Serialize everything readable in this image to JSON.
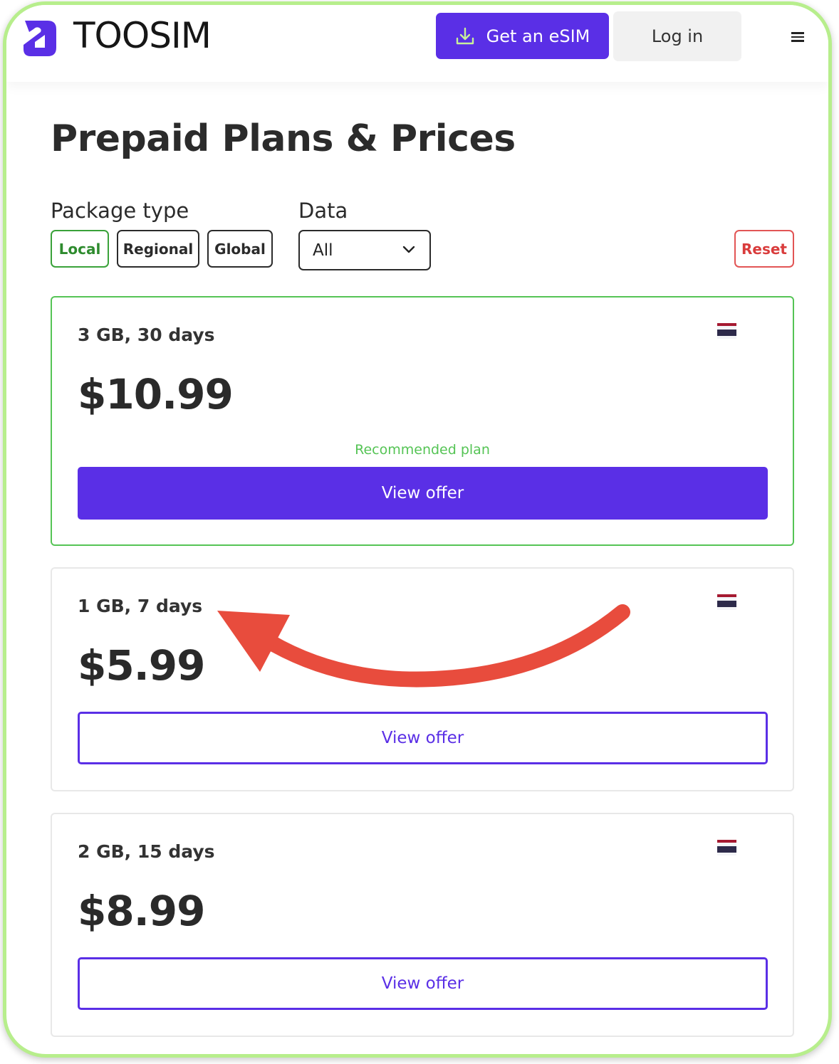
{
  "header": {
    "brand": "TOOSIM",
    "get_esim_label": "Get an eSIM",
    "login_label": "Log in"
  },
  "page": {
    "title": "Prepaid Plans & Prices"
  },
  "filters": {
    "package_type_label": "Package type",
    "package_types": [
      "Local",
      "Regional",
      "Global"
    ],
    "active_package_type": "Local",
    "data_label": "Data",
    "data_value": "All",
    "reset_label": "Reset"
  },
  "plans": [
    {
      "title": "3 GB, 30 days",
      "price": "$10.99",
      "badge": "Recommended plan",
      "button": "View offer"
    },
    {
      "title": "1 GB, 7 days",
      "price": "$5.99",
      "button": "View offer"
    },
    {
      "title": "2 GB, 15 days",
      "price": "$8.99",
      "button": "View offer"
    }
  ],
  "colors": {
    "accent": "#5a2fe6",
    "recommended": "#55c455",
    "reset": "#e25555",
    "annotation_arrow": "#e84c3d",
    "frame": "#b7ee8c"
  },
  "icons": {
    "logo": "toosim-logo-icon",
    "download": "download-icon",
    "menu": "hamburger-menu-icon",
    "dropdown": "chevron-down-icon",
    "flag": "thailand-flag-icon"
  }
}
